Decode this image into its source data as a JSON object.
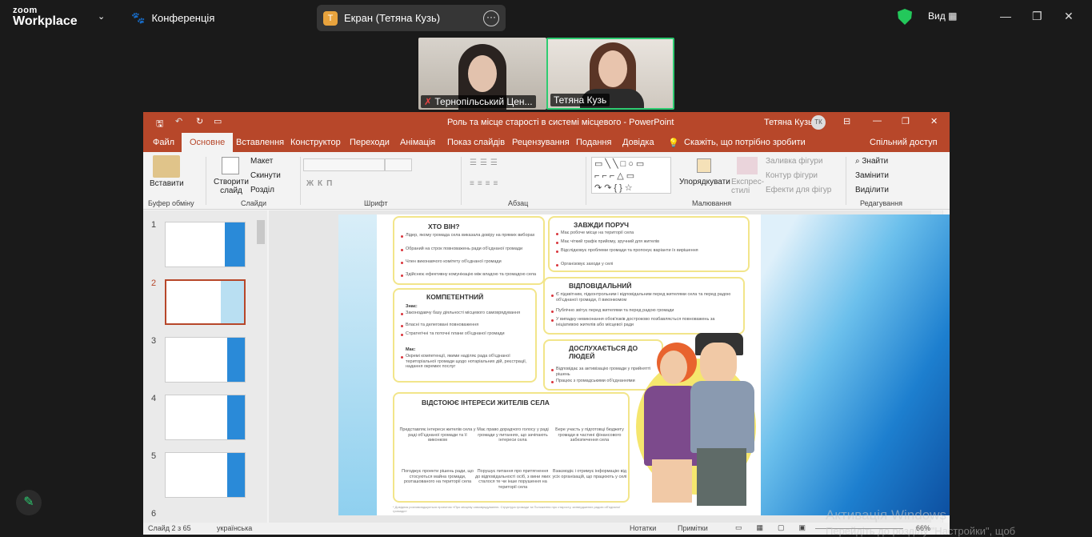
{
  "zoom": {
    "logo_small": "zoom",
    "logo_big": "Workplace",
    "conference_label": "Конференція",
    "share_pill": {
      "initial": "T",
      "label": "Екран (Тетяна Кузь)"
    },
    "view_label": "Вид",
    "participants": [
      {
        "name": "Тернопільський Цен..."
      },
      {
        "name": "Тетяна Кузь"
      }
    ]
  },
  "ppt": {
    "title": "Роль та місце старості в системі місцевого  -  PowerPoint",
    "user": "Тетяна Кузь",
    "user_initials": "ТК",
    "tabs": [
      "Файл",
      "Основне",
      "Вставлення",
      "Конструктор",
      "Переходи",
      "Анімація",
      "Показ слайдів",
      "Рецензування",
      "Подання",
      "Довідка"
    ],
    "tell_me": "Скажіть, що потрібно зробити",
    "share": "Спільний доступ",
    "ribbon": {
      "paste": "Вставити",
      "new_slide": "Створити слайд",
      "layout": "Макет",
      "reset": "Скинути",
      "section": "Розділ",
      "arrange": "Упорядкувати",
      "quick_styles": "Експрес-стилі",
      "shape_fill": "Заливка фігури",
      "shape_outline": "Контур фігури",
      "shape_effects": "Ефекти для фігур",
      "find": "Знайти",
      "replace": "Замінити",
      "select": "Виділити",
      "groups": [
        "Буфер обміну",
        "Слайди",
        "Шрифт",
        "Абзац",
        "Малювання",
        "Редагування"
      ]
    },
    "slide_numbers": [
      "1",
      "2",
      "3",
      "4",
      "5",
      "6"
    ],
    "status": {
      "slide": "Слайд 2 з 65",
      "lang": "українська",
      "notes": "Нотатки",
      "comments": "Примітки",
      "zoom": "66%"
    }
  },
  "slide": {
    "who": {
      "title": "ХТО ВІН?",
      "items": [
        "Лідер, якому громада села виказала довіру на прямих виборах",
        "Обраний на строк повноважень ради об'єднаної громади",
        "Член виконавчого комітету об'єднаної громади",
        "Здійснює ефективну комунікацію між владою та громадою села"
      ]
    },
    "always": {
      "title": "ЗАВЖДИ ПОРУЧ",
      "items": [
        "Має робоче місце на території села",
        "Має чіткий графік прийому, зручний для жителів",
        "Відслідковує проблеми громади та пропонує варіанти їх вирішення",
        "Організовує заходи у селі"
      ]
    },
    "competent": {
      "title": "КОМПЕТЕНТНИЙ",
      "knows": "Знає:",
      "knows_items": [
        "Законодавчу базу діяльності місцевого самоврядування",
        "Власні та делеговані повноваження",
        "Стратегічні та поточні плани об'єднаної громади"
      ],
      "has": "Має:",
      "has_items": [
        "Окремі компетенції, якими наділяє рада об'єднаної територіальної громади щодо нотаріальних дій, реєстрації, надання окремих послуг"
      ]
    },
    "responsible": {
      "title": "ВІДПОВІДАЛЬНИЙ",
      "items": [
        "Є підзвітним, підконтрольним і відповідальним перед жителями села та перед радою об'єднаної громади, її виконкомом",
        "Публічно звітує перед жителями та перед радою громади",
        "У випадку невиконання обов'язків достроково позбавляється повноважень за ініціативою жителів або місцевої ради"
      ]
    },
    "listens": {
      "title": "ДОСЛУХАЄТЬСЯ ДО ЛЮДЕЙ",
      "items": [
        "Відповідає за активізацію громади у прийнятті рішень",
        "Працює з громадськими об'єднаннями"
      ]
    },
    "defends": {
      "title": "ВІДСТОЮЄ ІНТЕРЕСИ ЖИТЕЛІВ СЕЛА",
      "items": [
        "Представляє інтереси жителів села у раді об'єднаної громади та її виконком",
        "Має право дорадчого голосу у раді громади у питаннях, що зачіпають інтереси села",
        "Бере участь у підготовці бюджету громади в частині фінансового забезпечення села",
        "Погоджує проекти рішень ради, що стосуються майна громади, розташованого на території села",
        "Порушує питання про притягнення до відповідальності осіб, з вини яких сталося те чи інше порушення на території села",
        "Взаємодіє і отримує інформацію від усіх організацій, що працюють у селі"
      ]
    },
    "footnote": "* Довідник розповсюджується проектом «Про місцеву самоврядуванню. Структура громади та Положення про старосту, затверджених радою об'єднаної громади»"
  },
  "windows": {
    "activate": "Активація Windows",
    "settings": "Перейдіть до розділу \"Настройки\", щоб"
  }
}
